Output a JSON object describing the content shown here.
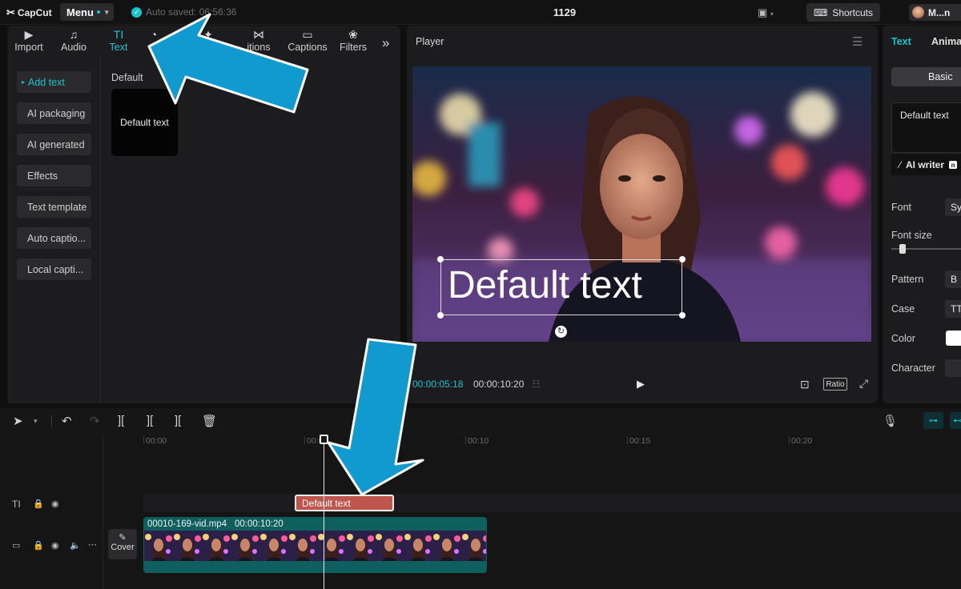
{
  "topbar": {
    "logo": "CapCut",
    "menu_label": "Menu",
    "autosave": "Auto saved: 06:56:36",
    "project_title": "1129",
    "shortcuts_label": "Shortcuts",
    "user_name": "M...n"
  },
  "toolbar": {
    "tabs": [
      {
        "label": "Import",
        "icon": "import-icon"
      },
      {
        "label": "Audio",
        "icon": "audio-icon"
      },
      {
        "label": "Text",
        "icon": "text-icon"
      },
      {
        "label": "S",
        "icon": "stickers-icon"
      },
      {
        "label": "",
        "icon": "effects-icon"
      },
      {
        "label": "itions",
        "icon": "transitions-icon"
      },
      {
        "label": "Captions",
        "icon": "captions-icon"
      },
      {
        "label": "Filters",
        "icon": "filters-icon"
      }
    ],
    "active_tab": "Text"
  },
  "sidenav": {
    "items": [
      "Add text",
      "AI packaging",
      "AI generated",
      "Effects",
      "Text template",
      "Auto captio...",
      "Local capti..."
    ]
  },
  "content": {
    "section_label": "Default",
    "thumb_text": "Default text"
  },
  "player": {
    "title": "Player",
    "overlay_text": "Default text",
    "time_current": "00:00:05:18",
    "time_total": "00:00:10:20",
    "ratio_label": "Ratio"
  },
  "inspector": {
    "tab_text": "Text",
    "tab_animation": "Anima",
    "basic_label": "Basic",
    "text_value": "Default text",
    "ai_writer": "AI writer",
    "font_label": "Font",
    "font_value": "Sy",
    "font_size_label": "Font size",
    "pattern_label": "Pattern",
    "pattern_value": "B",
    "case_label": "Case",
    "case_value": "TT",
    "color_label": "Color",
    "color_value": "#ffffff",
    "character_label": "Character"
  },
  "timeline": {
    "ruler": [
      "00:00",
      "00:0",
      "00:10",
      "00:15",
      "00:20"
    ],
    "text_clip": "Default text",
    "video_clip_name": "00010-169-vid.mp4",
    "video_clip_duration": "00:00:10:20",
    "cover_label": "Cover"
  },
  "colors": {
    "accent": "#19c3d0",
    "annotation_arrow": "#109ad0",
    "text_clip": "#c0554b",
    "video_clip": "#0f5f5f"
  }
}
